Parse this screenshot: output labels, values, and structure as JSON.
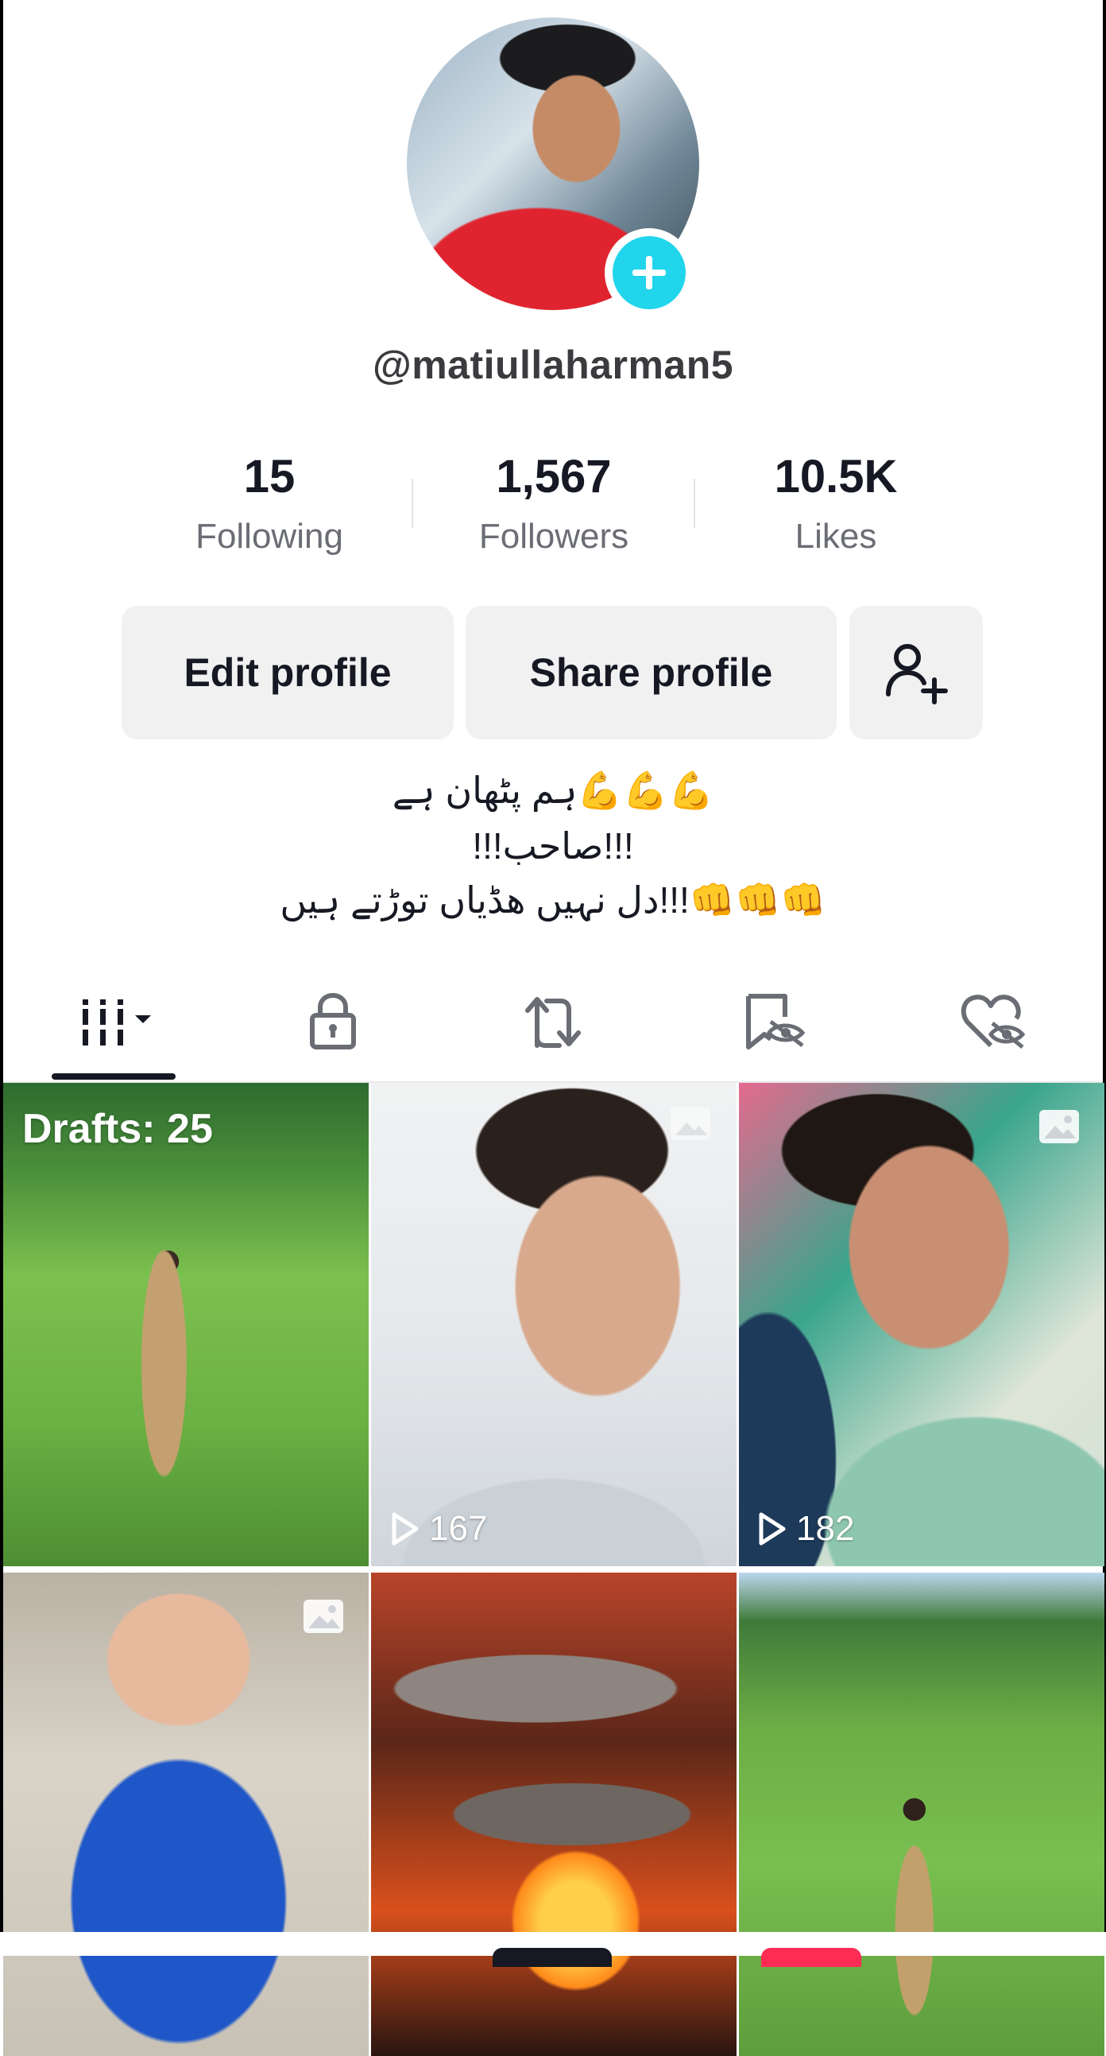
{
  "profile": {
    "username": "@matiullaharman5"
  },
  "stats": [
    {
      "value": "15",
      "label": "Following"
    },
    {
      "value": "1,567",
      "label": "Followers"
    },
    {
      "value": "10.5K",
      "label": "Likes"
    }
  ],
  "buttons": {
    "edit": "Edit profile",
    "share": "Share profile"
  },
  "bio": [
    "💪💪💪ہم پٹھان ہے",
    "!!!صاحب!!!",
    "👊👊👊!!!دل نہیں ھڈیاں توڑتے ہیں"
  ],
  "tabs": [
    {
      "name": "videos",
      "icon": "grid-icon"
    },
    {
      "name": "private",
      "icon": "lock-icon"
    },
    {
      "name": "reposts",
      "icon": "repost-icon"
    },
    {
      "name": "favorites",
      "icon": "bookmark-hidden-icon"
    },
    {
      "name": "liked",
      "icon": "heart-hidden-icon"
    }
  ],
  "grid": {
    "drafts_label": "Drafts: 25",
    "tiles": [
      {
        "views": ""
      },
      {
        "views": "167"
      },
      {
        "views": "182"
      },
      {
        "views": ""
      },
      {
        "views": ""
      },
      {
        "views": ""
      }
    ]
  },
  "colors": {
    "accent": "#20d5ec",
    "button_bg": "#f1f1f2",
    "text": "#161823",
    "secondary": "#6b6d75"
  }
}
